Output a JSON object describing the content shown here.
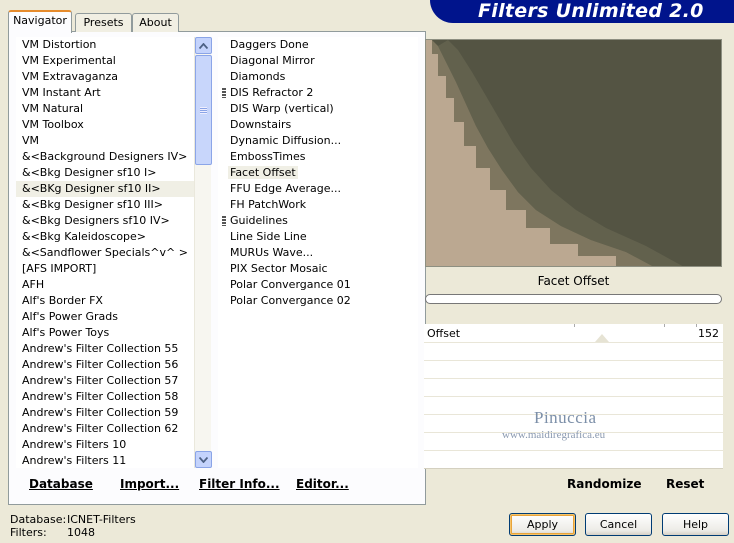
{
  "window": {
    "banner_title": "Filters Unlimited 2.0"
  },
  "tabs": [
    {
      "label": "Navigator",
      "active": true
    },
    {
      "label": "Presets",
      "active": false
    },
    {
      "label": "About",
      "active": false
    }
  ],
  "categories": {
    "items": [
      "VM Distortion",
      "VM Experimental",
      "VM Extravaganza",
      "VM Instant Art",
      "VM Natural",
      "VM Toolbox",
      "VM",
      "&<Background Designers IV>",
      "&<Bkg Designer sf10 I>",
      "&<BKg Designer sf10 II>",
      "&<Bkg Designer sf10 III>",
      "&<Bkg Designers sf10 IV>",
      "&<Bkg Kaleidoscope>",
      "&<Sandflower Specials^v^ >",
      "[AFS IMPORT]",
      "AFH",
      "Alf's Border FX",
      "Alf's Power Grads",
      "Alf's Power Toys",
      "Andrew's Filter Collection 55",
      "Andrew's Filter Collection 56",
      "Andrew's Filter Collection 57",
      "Andrew's Filter Collection 58",
      "Andrew's Filter Collection 59",
      "Andrew's Filter Collection 62",
      "Andrew's Filters 10",
      "Andrew's Filters 11"
    ],
    "selected": "&<BKg Designer sf10 II>"
  },
  "filters": {
    "items": [
      {
        "label": "Daggers Done",
        "group": false
      },
      {
        "label": "Diagonal Mirror",
        "group": false
      },
      {
        "label": "Diamonds",
        "group": false
      },
      {
        "label": "DIS Refractor 2",
        "group": true
      },
      {
        "label": "DIS Warp (vertical)",
        "group": false
      },
      {
        "label": "Downstairs",
        "group": false
      },
      {
        "label": "Dynamic Diffusion...",
        "group": false
      },
      {
        "label": "EmbossTimes",
        "group": false
      },
      {
        "label": "Facet Offset",
        "group": false
      },
      {
        "label": "FFU Edge Average...",
        "group": false
      },
      {
        "label": "FH PatchWork",
        "group": false
      },
      {
        "label": "Guidelines",
        "group": true
      },
      {
        "label": "Line Side Line",
        "group": false
      },
      {
        "label": "MURUs Wave...",
        "group": false
      },
      {
        "label": "PIX Sector Mosaic",
        "group": false
      },
      {
        "label": "Polar Convergance 01",
        "group": false
      },
      {
        "label": "Polar Convergance 02",
        "group": false
      }
    ],
    "selected": "Facet Offset"
  },
  "nav_buttons": {
    "database": "Database",
    "import": "Import...",
    "filter_info": "Filter Info...",
    "editor": "Editor..."
  },
  "preview": {
    "filter_name": "Facet Offset",
    "colors": {
      "light": "#bba891",
      "dark": "#545443"
    }
  },
  "parameters": [
    {
      "label": "Offset",
      "value": "152"
    }
  ],
  "watermark": {
    "name": "Pinuccia",
    "url": "www.maidiregrafica.eu"
  },
  "param_buttons": {
    "randomize": "Randomize",
    "reset": "Reset"
  },
  "status": {
    "database_label": "Database:",
    "database_value": "ICNET-Filters",
    "filters_label": "Filters:",
    "filters_value": "1048"
  },
  "dialog_buttons": {
    "apply": "Apply",
    "cancel": "Cancel",
    "help": "Help"
  }
}
